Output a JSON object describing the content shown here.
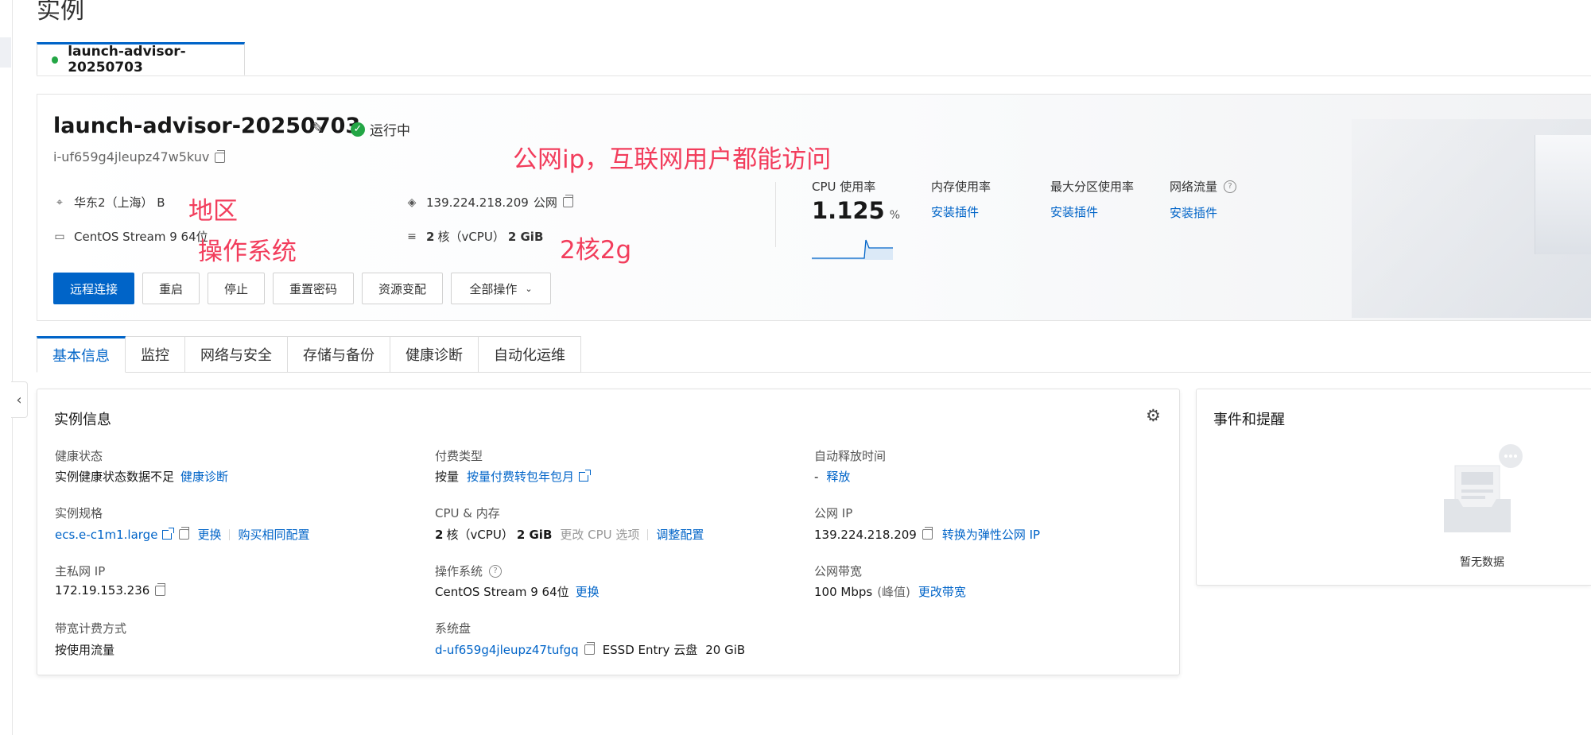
{
  "page": {
    "title": "实例"
  },
  "instance_tab": {
    "label": "launch-advisor-20250703",
    "status_color": "#23a645"
  },
  "summary": {
    "name": "launch-advisor-20250703",
    "status": "运行中",
    "instance_id": "i-uf659g4jleupz47w5kuv",
    "region": "华东2（上海） B",
    "os": "CentOS Stream 9 64位",
    "public_ip": "139.224.218.209",
    "public_ip_suffix": "公网",
    "spec_cores": "2",
    "spec_core_unit": "核（vCPU）",
    "spec_mem": "2 GiB",
    "buttons": {
      "remote": "远程连接",
      "restart": "重启",
      "stop": "停止",
      "reset_pwd": "重置密码",
      "resize": "资源变配",
      "all_ops": "全部操作"
    },
    "metrics": {
      "cpu_label": "CPU 使用率",
      "cpu_value": "1.125",
      "cpu_unit": "%",
      "mem_label": "内存使用率",
      "mem_link": "安装插件",
      "disk_label": "最大分区使用率",
      "disk_link": "安装插件",
      "net_label": "网络流量",
      "net_link": "安装插件"
    }
  },
  "annotations": {
    "public_ip_note": "公网ip，互联网用户都能访问",
    "region_note": "地区",
    "os_note": "操作系统",
    "spec_note": "2核2g",
    "color": "#f23d5c"
  },
  "tabs": [
    "基本信息",
    "监控",
    "网络与安全",
    "存储与备份",
    "健康诊断",
    "自动化运维"
  ],
  "info": {
    "title": "实例信息",
    "health_label": "健康状态",
    "health_value": "实例健康状态数据不足",
    "health_link": "健康诊断",
    "billing_label": "付费类型",
    "billing_value": "按量",
    "billing_link": "按量付费转包年包月",
    "release_label": "自动释放时间",
    "release_value": "-",
    "release_link": "释放",
    "spec_label": "实例规格",
    "spec_value": "ecs.e-c1m1.large",
    "spec_change": "更换",
    "spec_buy": "购买相同配置",
    "cpu_mem_label": "CPU & 内存",
    "cpu_cores": "2",
    "cpu_unit": "核（vCPU）",
    "mem": "2 GiB",
    "cpu_option": "更改 CPU 选项",
    "cpu_adjust": "调整配置",
    "pub_ip_label": "公网 IP",
    "pub_ip_value": "139.224.218.209",
    "pub_ip_link": "转换为弹性公网 IP",
    "priv_ip_label": "主私网 IP",
    "priv_ip_value": "172.19.153.236",
    "os_label": "操作系统",
    "os_value": "CentOS Stream 9 64位",
    "os_link": "更换",
    "bw_label": "公网带宽",
    "bw_value": "100 Mbps",
    "bw_peak": "(峰值)",
    "bw_link": "更改带宽",
    "bw_billing_label": "带宽计费方式",
    "bw_billing_value": "按使用流量",
    "disk_label": "系统盘",
    "disk_id": "d-uf659g4jleupz47tufgq",
    "disk_type": "ESSD Entry 云盘",
    "disk_size": "20 GiB"
  },
  "events": {
    "title": "事件和提醒",
    "empty": "暂无数据"
  },
  "colors": {
    "primary": "#0064c8",
    "running": "#23a645"
  }
}
